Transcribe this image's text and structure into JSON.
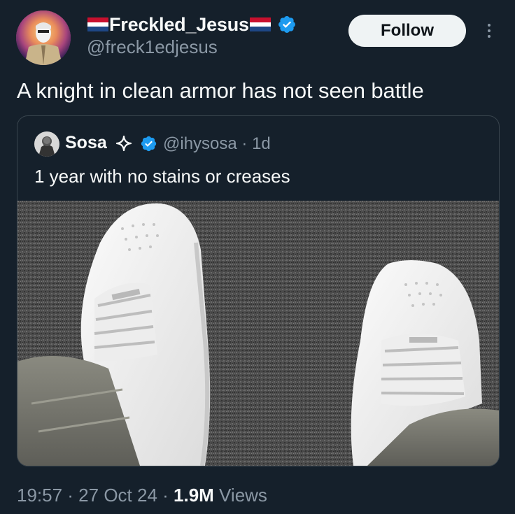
{
  "author": {
    "display_name": "Freckled_Jesus",
    "handle": "@freck1edjesus",
    "verified": true,
    "flag": "netherlands-flag"
  },
  "follow_button": {
    "label": "Follow"
  },
  "more_icon": "more-vertical-icon",
  "tweet": {
    "text": "A knight in clean armor has not seen battle"
  },
  "quoted_tweet": {
    "display_name": "Sosa",
    "handle_meta": "@ihysosa · 1d",
    "text": "1 year with no stains or creases",
    "verified": true,
    "image_alt": "white-sneakers-photo"
  },
  "footer": {
    "time_date": "19:57 · 27 Oct 24 · ",
    "views_count": "1.9M",
    "views_label": " Views"
  },
  "colors": {
    "background": "#15202b",
    "text_primary": "#f7f9f9",
    "text_secondary": "#8b98a5",
    "verified_blue": "#1d9bf0",
    "border": "#38444d",
    "follow_bg": "#eff3f4"
  }
}
